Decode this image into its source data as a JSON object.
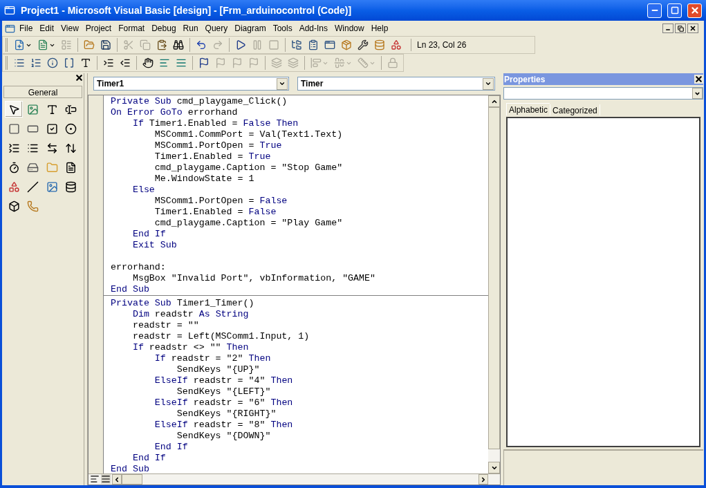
{
  "window": {
    "title": "Project1 - Microsoft Visual Basic [design] - [Frm_arduinocontrol (Code)]"
  },
  "menu": [
    "File",
    "Edit",
    "View",
    "Project",
    "Format",
    "Debug",
    "Run",
    "Query",
    "Diagram",
    "Tools",
    "Add-Ins",
    "Window",
    "Help"
  ],
  "toolbars": [
    {
      "items": [
        {
          "kind": "button",
          "disabled": false,
          "dropdown": true
        },
        {
          "kind": "button",
          "disabled": false,
          "dropdown": true
        },
        {
          "kind": "button",
          "disabled": true,
          "dropdown": false
        },
        {
          "kind": "separator"
        },
        {
          "kind": "button",
          "disabled": false,
          "dropdown": false
        },
        {
          "kind": "button",
          "disabled": false,
          "dropdown": false
        },
        {
          "kind": "separator"
        },
        {
          "kind": "button",
          "disabled": true,
          "dropdown": false
        },
        {
          "kind": "button",
          "disabled": true,
          "dropdown": false
        },
        {
          "kind": "button",
          "disabled": false,
          "dropdown": false
        },
        {
          "kind": "button",
          "disabled": false,
          "dropdown": false
        },
        {
          "kind": "separator"
        },
        {
          "kind": "button",
          "disabled": false,
          "dropdown": false
        },
        {
          "kind": "button",
          "disabled": true,
          "dropdown": false
        },
        {
          "kind": "separator"
        },
        {
          "kind": "button",
          "disabled": false,
          "dropdown": false
        },
        {
          "kind": "button",
          "disabled": true,
          "dropdown": false
        },
        {
          "kind": "button",
          "disabled": true,
          "dropdown": false
        },
        {
          "kind": "separator"
        },
        {
          "kind": "button",
          "disabled": false,
          "dropdown": false
        },
        {
          "kind": "button",
          "disabled": false,
          "dropdown": false
        },
        {
          "kind": "button",
          "disabled": false,
          "dropdown": false
        },
        {
          "kind": "button",
          "disabled": false,
          "dropdown": false
        },
        {
          "kind": "button",
          "disabled": false,
          "dropdown": false
        },
        {
          "kind": "button",
          "disabled": false,
          "dropdown": false
        },
        {
          "kind": "button",
          "disabled": false,
          "dropdown": false
        }
      ],
      "position": "Ln 23, Col 26"
    },
    {
      "items": [
        {
          "kind": "button",
          "disabled": false,
          "dropdown": false
        },
        {
          "kind": "button",
          "disabled": false,
          "dropdown": false
        },
        {
          "kind": "button",
          "disabled": false,
          "dropdown": false
        },
        {
          "kind": "button",
          "disabled": false,
          "dropdown": false
        },
        {
          "kind": "button",
          "disabled": false,
          "dropdown": false
        },
        {
          "kind": "separator"
        },
        {
          "kind": "button",
          "disabled": false,
          "dropdown": false
        },
        {
          "kind": "button",
          "disabled": false,
          "dropdown": false
        },
        {
          "kind": "separator"
        },
        {
          "kind": "button",
          "disabled": false,
          "dropdown": false
        },
        {
          "kind": "button",
          "disabled": false,
          "dropdown": false
        },
        {
          "kind": "button",
          "disabled": false,
          "dropdown": false
        },
        {
          "kind": "separator"
        },
        {
          "kind": "button",
          "disabled": false,
          "dropdown": false
        },
        {
          "kind": "button",
          "disabled": true,
          "dropdown": false
        },
        {
          "kind": "button",
          "disabled": true,
          "dropdown": false
        },
        {
          "kind": "button",
          "disabled": true,
          "dropdown": false
        },
        {
          "kind": "separator"
        },
        {
          "kind": "button",
          "disabled": true,
          "dropdown": false
        },
        {
          "kind": "button",
          "disabled": true,
          "dropdown": false
        },
        {
          "kind": "separator"
        },
        {
          "kind": "button",
          "disabled": true,
          "dropdown": true
        },
        {
          "kind": "button",
          "disabled": true,
          "dropdown": true
        },
        {
          "kind": "button",
          "disabled": true,
          "dropdown": true
        },
        {
          "kind": "separator"
        },
        {
          "kind": "button",
          "disabled": true,
          "dropdown": false
        }
      ]
    }
  ],
  "toolbox": {
    "tab": "General",
    "tools": [
      {
        "selected": true
      },
      {
        "selected": false
      },
      {
        "selected": false
      },
      {
        "selected": false
      },
      {
        "selected": false
      },
      {
        "selected": false
      },
      {
        "selected": false
      },
      {
        "selected": false
      },
      {
        "selected": false
      },
      {
        "selected": false
      },
      {
        "selected": false
      },
      {
        "selected": false
      },
      {
        "selected": false
      },
      {
        "selected": false
      },
      {
        "selected": false
      },
      {
        "selected": false
      },
      {
        "selected": false
      },
      {
        "selected": false
      },
      {
        "selected": false
      },
      {
        "selected": false
      },
      {
        "selected": false
      },
      {
        "selected": false
      }
    ]
  },
  "code_window": {
    "object": "Timer1",
    "procedure": "Timer",
    "procedures": [
      {
        "lines": [
          {
            "kind": "code",
            "tokens": [
              {
                "kind": "keyword",
                "text": "Private Sub"
              },
              {
                "kind": "text",
                "text": " cmd_playgame_Click()"
              }
            ]
          },
          {
            "kind": "code",
            "tokens": [
              {
                "kind": "keyword",
                "text": "On Error GoTo"
              },
              {
                "kind": "text",
                "text": " errorhand"
              }
            ]
          },
          {
            "kind": "code",
            "tokens": [
              {
                "kind": "keyword",
                "text": "    If"
              },
              {
                "kind": "text",
                "text": " Timer1.Enabled = "
              },
              {
                "kind": "keyword",
                "text": "False Then"
              }
            ]
          },
          {
            "kind": "code",
            "tokens": [
              {
                "kind": "text",
                "text": "        MSComm1.CommPort = Val(Text1.Text)"
              }
            ]
          },
          {
            "kind": "code",
            "tokens": [
              {
                "kind": "text",
                "text": "        MSComm1.PortOpen = "
              },
              {
                "kind": "keyword",
                "text": "True"
              }
            ]
          },
          {
            "kind": "code",
            "tokens": [
              {
                "kind": "text",
                "text": "        Timer1.Enabled = "
              },
              {
                "kind": "keyword",
                "text": "True"
              }
            ]
          },
          {
            "kind": "code",
            "tokens": [
              {
                "kind": "text",
                "text": "        cmd_playgame.Caption = \"Stop Game\""
              }
            ]
          },
          {
            "kind": "code",
            "tokens": [
              {
                "kind": "text",
                "text": "        Me.WindowState = 1"
              }
            ]
          },
          {
            "kind": "code",
            "tokens": [
              {
                "kind": "keyword",
                "text": "    Else"
              }
            ]
          },
          {
            "kind": "code",
            "tokens": [
              {
                "kind": "text",
                "text": "        MSComm1.PortOpen = "
              },
              {
                "kind": "keyword",
                "text": "False"
              }
            ]
          },
          {
            "kind": "code",
            "tokens": [
              {
                "kind": "text",
                "text": "        Timer1.Enabled = "
              },
              {
                "kind": "keyword",
                "text": "False"
              }
            ]
          },
          {
            "kind": "code",
            "tokens": [
              {
                "kind": "text",
                "text": "        cmd_playgame.Caption = \"Play Game\""
              }
            ]
          },
          {
            "kind": "code",
            "tokens": [
              {
                "kind": "keyword",
                "text": "    End If"
              }
            ]
          },
          {
            "kind": "code",
            "tokens": [
              {
                "kind": "keyword",
                "text": "    Exit Sub"
              }
            ]
          },
          {
            "kind": "blank"
          },
          {
            "kind": "code",
            "tokens": [
              {
                "kind": "text",
                "text": "errorhand:"
              }
            ]
          },
          {
            "kind": "code",
            "tokens": [
              {
                "kind": "text",
                "text": "    MsgBox \"Invalid Port\", vbInformation, \"GAME\""
              }
            ]
          },
          {
            "kind": "code",
            "tokens": [
              {
                "kind": "keyword",
                "text": "End Sub"
              }
            ]
          }
        ]
      },
      {
        "lines": [
          {
            "kind": "code",
            "tokens": [
              {
                "kind": "keyword",
                "text": "Private Sub"
              },
              {
                "kind": "text",
                "text": " Timer1_Timer()"
              }
            ]
          },
          {
            "kind": "code",
            "tokens": [
              {
                "kind": "keyword",
                "text": "    Dim"
              },
              {
                "kind": "text",
                "text": " readstr "
              },
              {
                "kind": "keyword",
                "text": "As String"
              }
            ]
          },
          {
            "kind": "code",
            "tokens": [
              {
                "kind": "text",
                "text": "    readstr = \"\""
              }
            ]
          },
          {
            "kind": "code",
            "tokens": [
              {
                "kind": "text",
                "text": "    readstr = Left(MSComm1.Input, 1)"
              }
            ]
          },
          {
            "kind": "code",
            "tokens": [
              {
                "kind": "keyword",
                "text": "    If"
              },
              {
                "kind": "text",
                "text": " readstr <> \"\" "
              },
              {
                "kind": "keyword",
                "text": "Then"
              }
            ]
          },
          {
            "kind": "code",
            "tokens": [
              {
                "kind": "keyword",
                "text": "        If"
              },
              {
                "kind": "text",
                "text": " readstr = \"2\" "
              },
              {
                "kind": "keyword",
                "text": "Then"
              }
            ]
          },
          {
            "kind": "code",
            "tokens": [
              {
                "kind": "text",
                "text": "            SendKeys \"{UP}\""
              }
            ]
          },
          {
            "kind": "code",
            "tokens": [
              {
                "kind": "keyword",
                "text": "        ElseIf"
              },
              {
                "kind": "text",
                "text": " readstr = \"4\" "
              },
              {
                "kind": "keyword",
                "text": "Then"
              }
            ]
          },
          {
            "kind": "code",
            "tokens": [
              {
                "kind": "text",
                "text": "            SendKeys \"{LEFT}\""
              }
            ]
          },
          {
            "kind": "code",
            "tokens": [
              {
                "kind": "keyword",
                "text": "        ElseIf"
              },
              {
                "kind": "text",
                "text": " readstr = \"6\" "
              },
              {
                "kind": "keyword",
                "text": "Then"
              }
            ]
          },
          {
            "kind": "code",
            "tokens": [
              {
                "kind": "text",
                "text": "            SendKeys \"{RIGHT}\""
              }
            ]
          },
          {
            "kind": "code",
            "tokens": [
              {
                "kind": "keyword",
                "text": "        ElseIf"
              },
              {
                "kind": "text",
                "text": " readstr = \"8\" "
              },
              {
                "kind": "keyword",
                "text": "Then"
              }
            ]
          },
          {
            "kind": "code",
            "tokens": [
              {
                "kind": "text",
                "text": "            SendKeys \"{DOWN}\""
              }
            ]
          },
          {
            "kind": "code",
            "tokens": [
              {
                "kind": "keyword",
                "text": "        End If"
              }
            ]
          },
          {
            "kind": "code",
            "tokens": [
              {
                "kind": "keyword",
                "text": "    End If"
              }
            ]
          },
          {
            "kind": "code",
            "tokens": [
              {
                "kind": "keyword",
                "text": "End Sub"
              }
            ]
          }
        ]
      }
    ]
  },
  "properties": {
    "title": "Properties",
    "tabs": [
      {
        "label": "Alphabetic",
        "selected": true
      },
      {
        "label": "Categorized",
        "selected": false
      }
    ]
  }
}
